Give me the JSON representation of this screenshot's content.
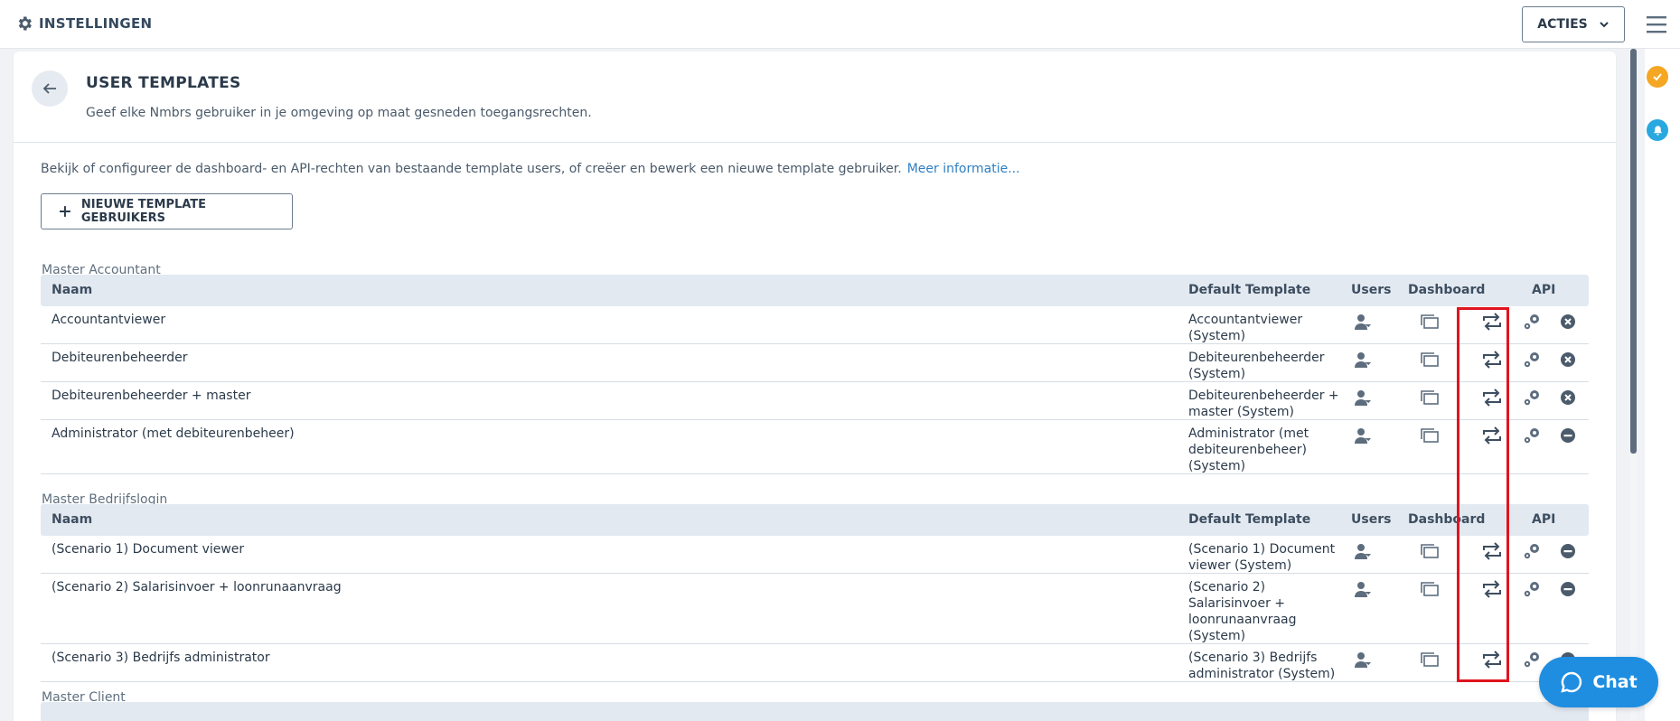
{
  "topbar": {
    "title": "INSTELLINGEN",
    "acties_label": "ACTIES"
  },
  "page": {
    "title": "USER TEMPLATES",
    "subtitle": "Geef elke Nmbrs gebruiker in je omgeving op maat gesneden toegangsrechten.",
    "intro": "Bekijk of configureer de dashboard- en API-rechten van bestaande template users, of creëer en bewerk een nieuwe template gebruiker.",
    "intro_link": "Meer informatie...",
    "new_button": "NIEUWE TEMPLATE GEBRUIKERS"
  },
  "columns": {
    "name": "Naam",
    "default_template": "Default Template",
    "users": "Users",
    "dashboard": "Dashboard",
    "api": "API"
  },
  "sections": [
    {
      "label": "Master Accountant",
      "rows": [
        {
          "name": "Accountantviewer",
          "template": "Accountantviewer (System)",
          "action": "delete"
        },
        {
          "name": "Debiteurenbeheerder",
          "template": "Debiteurenbeheerder (System)",
          "action": "delete"
        },
        {
          "name": "Debiteurenbeheerder + master",
          "template": "Debiteurenbeheerder + master (System)",
          "action": "delete"
        },
        {
          "name": "Administrator (met debiteurenbeheer)",
          "template": "Administrator (met debiteurenbeheer) (System)",
          "action": "disabled"
        }
      ]
    },
    {
      "label": "Master Bedrijfslogin",
      "rows": [
        {
          "name": "(Scenario 1) Document viewer",
          "template": "(Scenario 1) Document viewer (System)",
          "action": "disabled"
        },
        {
          "name": "(Scenario 2) Salarisinvoer + loonrunaanvraag",
          "template": "(Scenario 2) Salarisinvoer + loonrunaanvraag (System)",
          "action": "disabled"
        },
        {
          "name": "(Scenario 3) Bedrijfs administrator",
          "template": "(Scenario 3) Bedrijfs administrator (System)",
          "action": "disabled"
        }
      ]
    },
    {
      "label": "Master Client",
      "rows": []
    }
  ],
  "chat": {
    "label": "Chat"
  },
  "colors": {
    "accent": "#1f8ee0",
    "highlight": "#e0141e",
    "header_bg": "#e3e9f1"
  }
}
